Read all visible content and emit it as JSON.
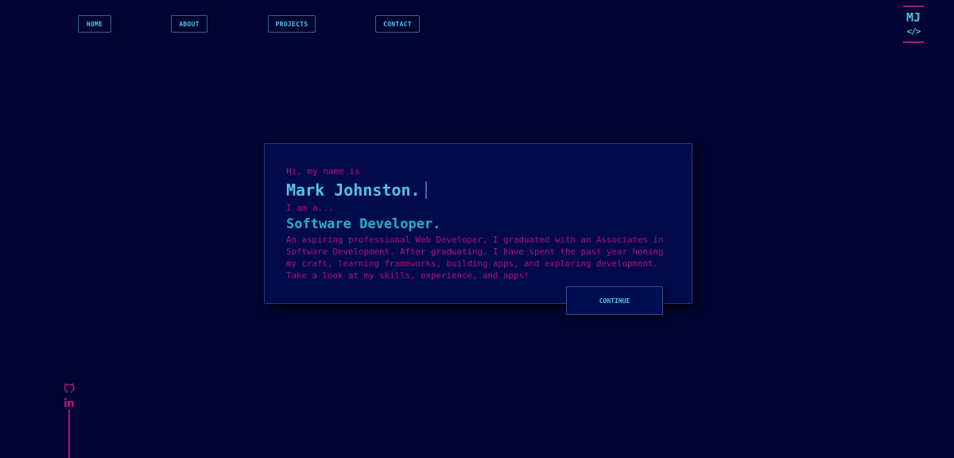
{
  "nav": {
    "home": "HOME",
    "about": "ABOUT",
    "projects": "PROJECTS",
    "contact": "CONTACT"
  },
  "logo": {
    "initials": "MJ",
    "code": "</>"
  },
  "hero": {
    "greeting": "Hi, my name is",
    "name": "Mark Johnston.",
    "intro": "I am a...",
    "role": "Software Developer.",
    "description": "An aspiring professional Web Developer, I graduated with an Associates in Software Development. After graduating, I have spent the past year honing my craft, learning frameworks, building apps, and exploring development. Take a look at my skills, experience, and apps!",
    "continue_label": "CONTINUE"
  },
  "social": {
    "icons": [
      "github-icon",
      "linkedin-icon"
    ]
  },
  "colors": {
    "background": "#020531",
    "accent_cyan": "#4fc3e8",
    "accent_magenta": "#b0117a",
    "card": "#020a4a"
  }
}
